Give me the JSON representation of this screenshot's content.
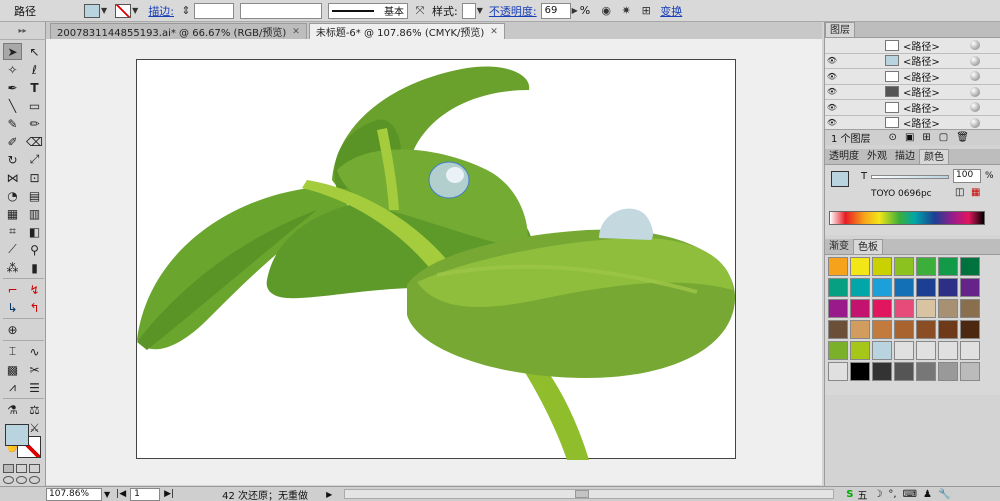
{
  "control_bar": {
    "object_type": "路径",
    "stroke_label": "描边:",
    "stroke_profile": "基本",
    "style_label": "样式:",
    "opacity_label": "不透明度:",
    "opacity_value": "69",
    "opacity_unit": "%",
    "transform_label": "变换",
    "fill_color": "#b9d3df"
  },
  "tabs": [
    {
      "label": "2007831144855193.ai* @ 66.67% (RGB/预览)",
      "active": false
    },
    {
      "label": "未标题-6* @ 107.86% (CMYK/预览)",
      "active": true
    }
  ],
  "layers_panel": {
    "title": "图层",
    "rows": [
      "<路径>",
      "<路径>",
      "<路径>",
      "<路径>",
      "<路径>",
      "<路径>"
    ],
    "footer_count": "1 个图层"
  },
  "transparency_tabs": [
    "透明度",
    "外观",
    "描边",
    "颜色"
  ],
  "color_panel": {
    "tint_label": "T",
    "tint_value": "100",
    "tint_unit": "%",
    "swatch_name": "TOYO 0696pc"
  },
  "swatch_tabs": [
    "渐变",
    "色板"
  ],
  "swatches": {
    "rows": [
      [
        "#f6a21a",
        "#f2e617",
        "#c9d200",
        "#8bc21f",
        "#3cae3a",
        "#139a48",
        "#00723e"
      ],
      [
        "#08a082",
        "#00a6a8",
        "#1d9fd9",
        "#1370b7",
        "#1c3f94",
        "#2d2f86",
        "#66248a"
      ],
      [
        "#9a1a8b",
        "#c4126f",
        "#e2165f",
        "#e64b7a",
        "#d8c4a0",
        "#a89173",
        "#8a6f4e"
      ],
      [
        "#6c4f37",
        "#d29c5e",
        "#c27b3c",
        "#a9632f",
        "#8b4d24",
        "#6f3a1a",
        "#4d2810"
      ],
      [
        "#7ab02a",
        "#a6c61a",
        "#b9d3df",
        "#e0e0e0",
        "#e0e0e0",
        "#e0e0e0",
        "#e0e0e0"
      ],
      [
        "#e0e0e0",
        "#000000",
        "#333333",
        "#555555",
        "#777777",
        "#999999",
        "#bbbbbb"
      ]
    ]
  },
  "status_bar": {
    "zoom": "107.86%",
    "page": "1",
    "history": "42 次还原；无重做"
  },
  "tray": {
    "ime": "五"
  }
}
